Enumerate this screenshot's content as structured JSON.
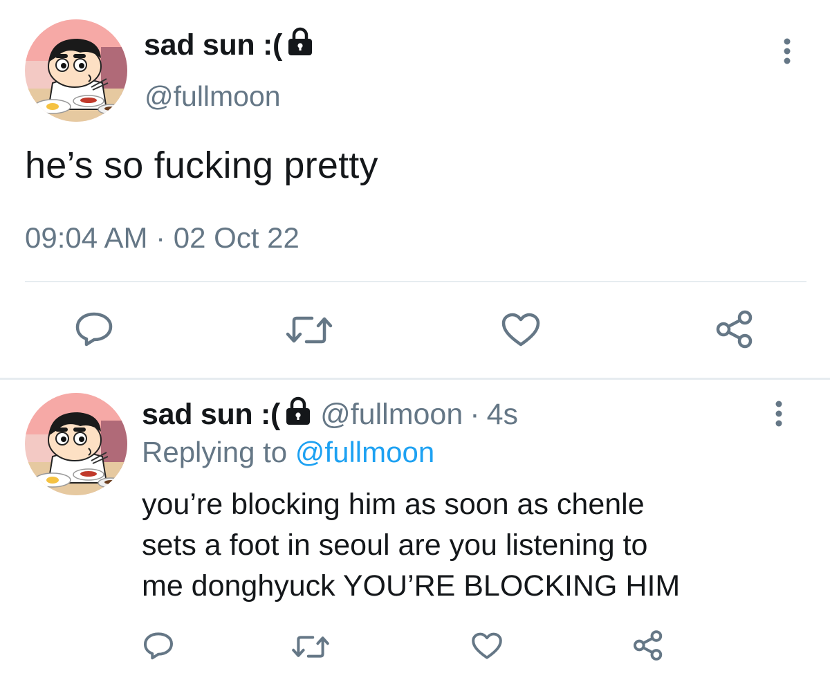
{
  "main_tweet": {
    "display_name": "sad sun :(",
    "handle": "@fullmoon",
    "text": "he’s so fucking pretty",
    "timestamp": "09:04 AM · 02 Oct 22",
    "avatar_icon": "cartoon-boy-avatar",
    "protected_icon": "lock-icon",
    "more_icon": "more-vertical-icon",
    "actions": {
      "reply_icon": "reply-icon",
      "retweet_icon": "retweet-icon",
      "like_icon": "heart-icon",
      "share_icon": "share-icon"
    }
  },
  "reply_tweet": {
    "display_name": "sad sun :(",
    "handle": "@fullmoon",
    "separator": "·",
    "time": "4s",
    "replying_label": "Replying to",
    "replying_mention": "@fullmoon",
    "text": "you’re blocking him as soon as chenle\nsets a foot in seoul are you listening to\nme donghyuck YOU’RE BLOCKING HIM",
    "avatar_icon": "cartoon-boy-avatar",
    "protected_icon": "lock-icon",
    "more_icon": "more-vertical-icon"
  },
  "colors": {
    "text_primary": "#14171a",
    "text_secondary": "#657786",
    "link": "#1da1f2",
    "divider": "#e6ecf0",
    "icon": "#657786"
  }
}
